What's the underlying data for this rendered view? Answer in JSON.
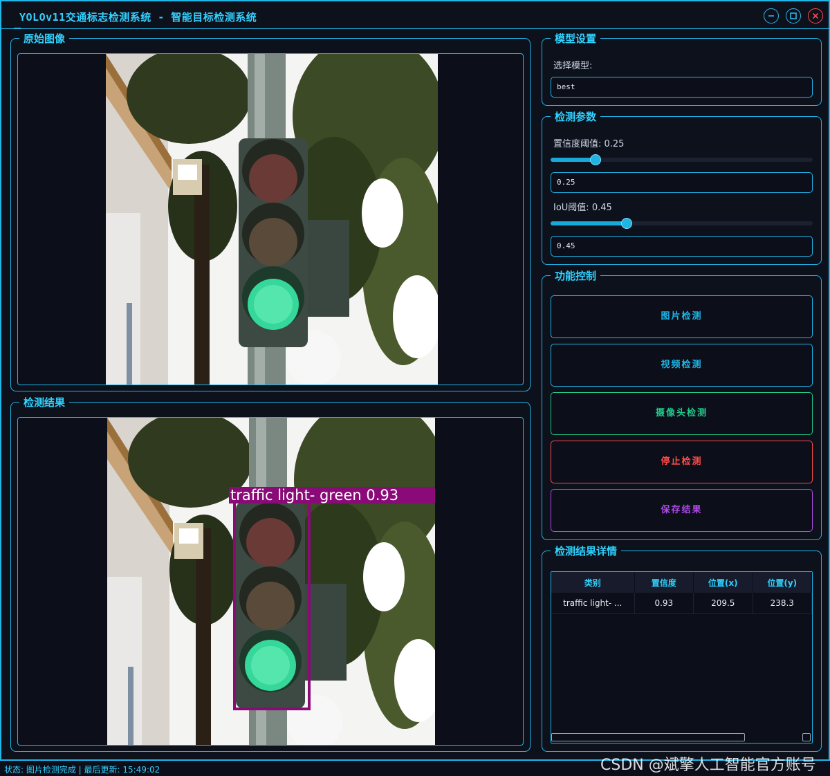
{
  "window": {
    "title": "YOLOv11交通标志检测系统 - 智能目标检测系统"
  },
  "panels": {
    "original_title": "原始图像",
    "result_title": "检测结果"
  },
  "detection_overlay": {
    "label": "traffic light- green 0.93",
    "color": "#8a0a78"
  },
  "model_settings": {
    "title": "模型设置",
    "select_label": "选择模型:",
    "selected_model": "best"
  },
  "detect_params": {
    "title": "检测参数",
    "confidence_label": "置信度阈值: 0.25",
    "confidence_value": "0.25",
    "confidence_level": 0.25,
    "iou_label": "IoU阈值: 0.45",
    "iou_value": "0.45",
    "iou_level": 0.45
  },
  "controls": {
    "title": "功能控制",
    "buttons": [
      {
        "label": "图片检测",
        "color": "#1fb6e8"
      },
      {
        "label": "视频检测",
        "color": "#1fb6e8"
      },
      {
        "label": "摄像头检测",
        "color": "#22c98a"
      },
      {
        "label": "停止检测",
        "color": "#ff4a4a"
      },
      {
        "label": "保存结果",
        "color": "#b04ae8"
      }
    ]
  },
  "results": {
    "title": "检测结果详情",
    "columns": [
      "类别",
      "置信度",
      "位置(x)",
      "位置(y)"
    ],
    "rows": [
      [
        "traffic light- ...",
        "0.93",
        "209.5",
        "238.3"
      ]
    ]
  },
  "status": {
    "text": "状态: 图片检测完成 | 最后更新: 15:49:02"
  },
  "watermark": "CSDN @斌擎人工智能官方账号",
  "colors": {
    "accent": "#1fb6e8",
    "title": "#33d0ff",
    "background": "#0d111c",
    "close": "#ff4a4a"
  }
}
